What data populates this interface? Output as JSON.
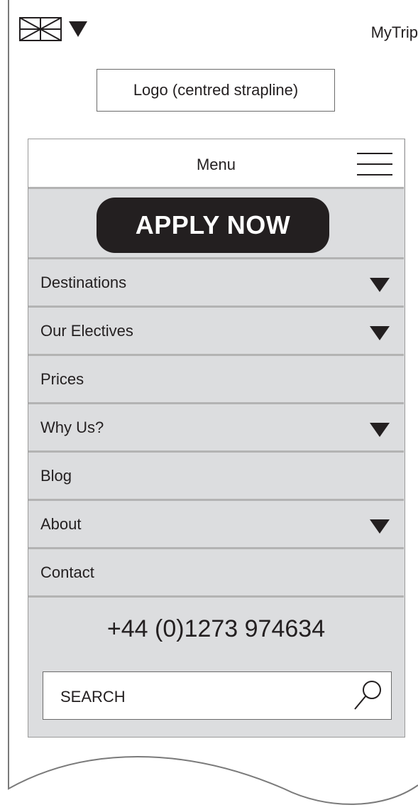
{
  "header": {
    "flag_icon": "uk-flag-icon",
    "dropdown_icon": "caret-down-icon",
    "mytrip_label": "MyTrip"
  },
  "logo": {
    "text": "Logo (centred strapline)"
  },
  "menu": {
    "label": "Menu",
    "hamburger_icon": "hamburger-icon",
    "apply_label": "APPLY NOW",
    "items": [
      {
        "label": "Destinations",
        "has_dropdown": true
      },
      {
        "label": "Our Electives",
        "has_dropdown": true
      },
      {
        "label": "Prices",
        "has_dropdown": false
      },
      {
        "label": "Why Us?",
        "has_dropdown": true
      },
      {
        "label": "Blog",
        "has_dropdown": false
      },
      {
        "label": "About",
        "has_dropdown": true
      },
      {
        "label": "Contact",
        "has_dropdown": false
      }
    ],
    "phone": "+44 (0)1273 974634",
    "search": {
      "placeholder": "SEARCH",
      "value": "",
      "icon": "search-icon"
    }
  },
  "colors": {
    "ink": "#231f20",
    "panel_bg": "#dcdddf",
    "divider": "#b3b3b3",
    "button_bg": "#231f20",
    "button_text": "#ffffff"
  }
}
